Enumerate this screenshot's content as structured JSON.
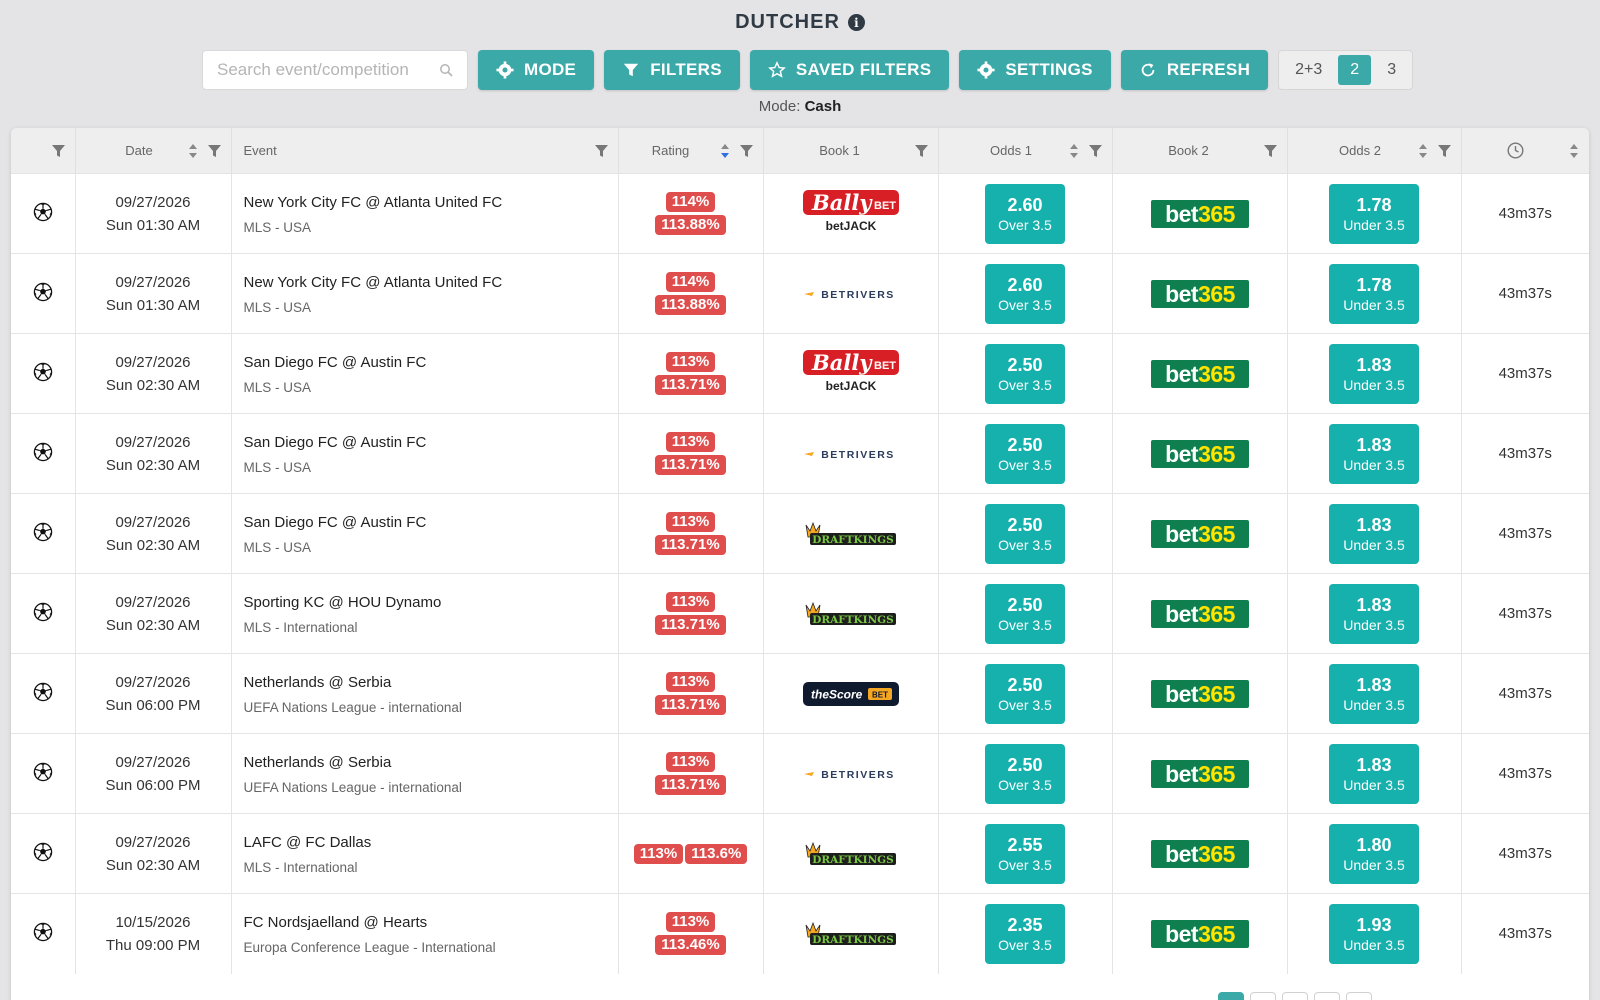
{
  "header": {
    "title": "DUTCHER"
  },
  "toolbar": {
    "search_placeholder": "Search event/competition",
    "mode_label": "MODE",
    "filters_label": "FILTERS",
    "saved_filters_label": "SAVED FILTERS",
    "settings_label": "SETTINGS",
    "refresh_label": "REFRESH",
    "segments": [
      "2+3",
      "2",
      "3"
    ],
    "active_segment": "2"
  },
  "mode_line": {
    "label": "Mode:",
    "value": "Cash"
  },
  "columns": {
    "date": "Date",
    "event": "Event",
    "rating": "Rating",
    "book1": "Book 1",
    "odds1": "Odds 1",
    "book2": "Book 2",
    "odds2": "Odds 2"
  },
  "rows": [
    {
      "date": "09/27/2026",
      "time": "Sun 01:30 AM",
      "event": "New York City FC @ Atlanta United FC",
      "competition": "MLS - USA",
      "rating_a": "114%",
      "rating_b": "113.88%",
      "rating_inline": false,
      "book1": "ballybet",
      "odds1": "2.60",
      "line1": "Over 3.5",
      "book2": "bet365",
      "odds2": "1.78",
      "line2": "Under 3.5",
      "timer": "43m37s"
    },
    {
      "date": "09/27/2026",
      "time": "Sun 01:30 AM",
      "event": "New York City FC @ Atlanta United FC",
      "competition": "MLS - USA",
      "rating_a": "114%",
      "rating_b": "113.88%",
      "rating_inline": false,
      "book1": "betrivers",
      "odds1": "2.60",
      "line1": "Over 3.5",
      "book2": "bet365",
      "odds2": "1.78",
      "line2": "Under 3.5",
      "timer": "43m37s"
    },
    {
      "date": "09/27/2026",
      "time": "Sun 02:30 AM",
      "event": "San Diego FC @ Austin FC",
      "competition": "MLS - USA",
      "rating_a": "113%",
      "rating_b": "113.71%",
      "rating_inline": false,
      "book1": "ballybet",
      "odds1": "2.50",
      "line1": "Over 3.5",
      "book2": "bet365",
      "odds2": "1.83",
      "line2": "Under 3.5",
      "timer": "43m37s"
    },
    {
      "date": "09/27/2026",
      "time": "Sun 02:30 AM",
      "event": "San Diego FC @ Austin FC",
      "competition": "MLS - USA",
      "rating_a": "113%",
      "rating_b": "113.71%",
      "rating_inline": false,
      "book1": "betrivers",
      "odds1": "2.50",
      "line1": "Over 3.5",
      "book2": "bet365",
      "odds2": "1.83",
      "line2": "Under 3.5",
      "timer": "43m37s"
    },
    {
      "date": "09/27/2026",
      "time": "Sun 02:30 AM",
      "event": "San Diego FC @ Austin FC",
      "competition": "MLS - USA",
      "rating_a": "113%",
      "rating_b": "113.71%",
      "rating_inline": false,
      "book1": "draftkings",
      "odds1": "2.50",
      "line1": "Over 3.5",
      "book2": "bet365",
      "odds2": "1.83",
      "line2": "Under 3.5",
      "timer": "43m37s"
    },
    {
      "date": "09/27/2026",
      "time": "Sun 02:30 AM",
      "event": "Sporting KC @ HOU Dynamo",
      "competition": "MLS - International",
      "rating_a": "113%",
      "rating_b": "113.71%",
      "rating_inline": false,
      "book1": "draftkings",
      "odds1": "2.50",
      "line1": "Over 3.5",
      "book2": "bet365",
      "odds2": "1.83",
      "line2": "Under 3.5",
      "timer": "43m37s"
    },
    {
      "date": "09/27/2026",
      "time": "Sun 06:00 PM",
      "event": "Netherlands @ Serbia",
      "competition": "UEFA Nations League - international",
      "rating_a": "113%",
      "rating_b": "113.71%",
      "rating_inline": false,
      "book1": "thescore",
      "odds1": "2.50",
      "line1": "Over 3.5",
      "book2": "bet365",
      "odds2": "1.83",
      "line2": "Under 3.5",
      "timer": "43m37s"
    },
    {
      "date": "09/27/2026",
      "time": "Sun 06:00 PM",
      "event": "Netherlands @ Serbia",
      "competition": "UEFA Nations League - international",
      "rating_a": "113%",
      "rating_b": "113.71%",
      "rating_inline": false,
      "book1": "betrivers",
      "odds1": "2.50",
      "line1": "Over 3.5",
      "book2": "bet365",
      "odds2": "1.83",
      "line2": "Under 3.5",
      "timer": "43m37s"
    },
    {
      "date": "09/27/2026",
      "time": "Sun 02:30 AM",
      "event": "LAFC @ FC Dallas",
      "competition": "MLS - International",
      "rating_a": "113%",
      "rating_b": "113.6%",
      "rating_inline": true,
      "book1": "draftkings",
      "odds1": "2.55",
      "line1": "Over 3.5",
      "book2": "bet365",
      "odds2": "1.80",
      "line2": "Under 3.5",
      "timer": "43m37s"
    },
    {
      "date": "10/15/2026",
      "time": "Thu 09:00 PM",
      "event": "FC Nordsjaelland @ Hearts",
      "competition": "Europa Conference League - International",
      "rating_a": "113%",
      "rating_b": "113.46%",
      "rating_inline": false,
      "book1": "draftkings",
      "odds1": "2.35",
      "line1": "Over 3.5",
      "book2": "bet365",
      "odds2": "1.93",
      "line2": "Under 3.5",
      "timer": "43m37s"
    }
  ],
  "logos": {
    "ballybet": {
      "top": "Bally",
      "top_suffix": "BET",
      "bottom": "betJACK"
    },
    "betrivers": {
      "text": "BETRIVERS"
    },
    "draftkings": {
      "text": "DRAFTKINGS"
    },
    "thescore": {
      "text": "theScore",
      "suffix": "BET"
    },
    "bet365": {
      "text": "bet365"
    }
  },
  "colors": {
    "accent": "#3aa9a8",
    "odds": "#17b1ad",
    "rating": "#e04d4d",
    "bet365_bg": "#0f7f4f",
    "bet365_text": "#ffe600"
  }
}
